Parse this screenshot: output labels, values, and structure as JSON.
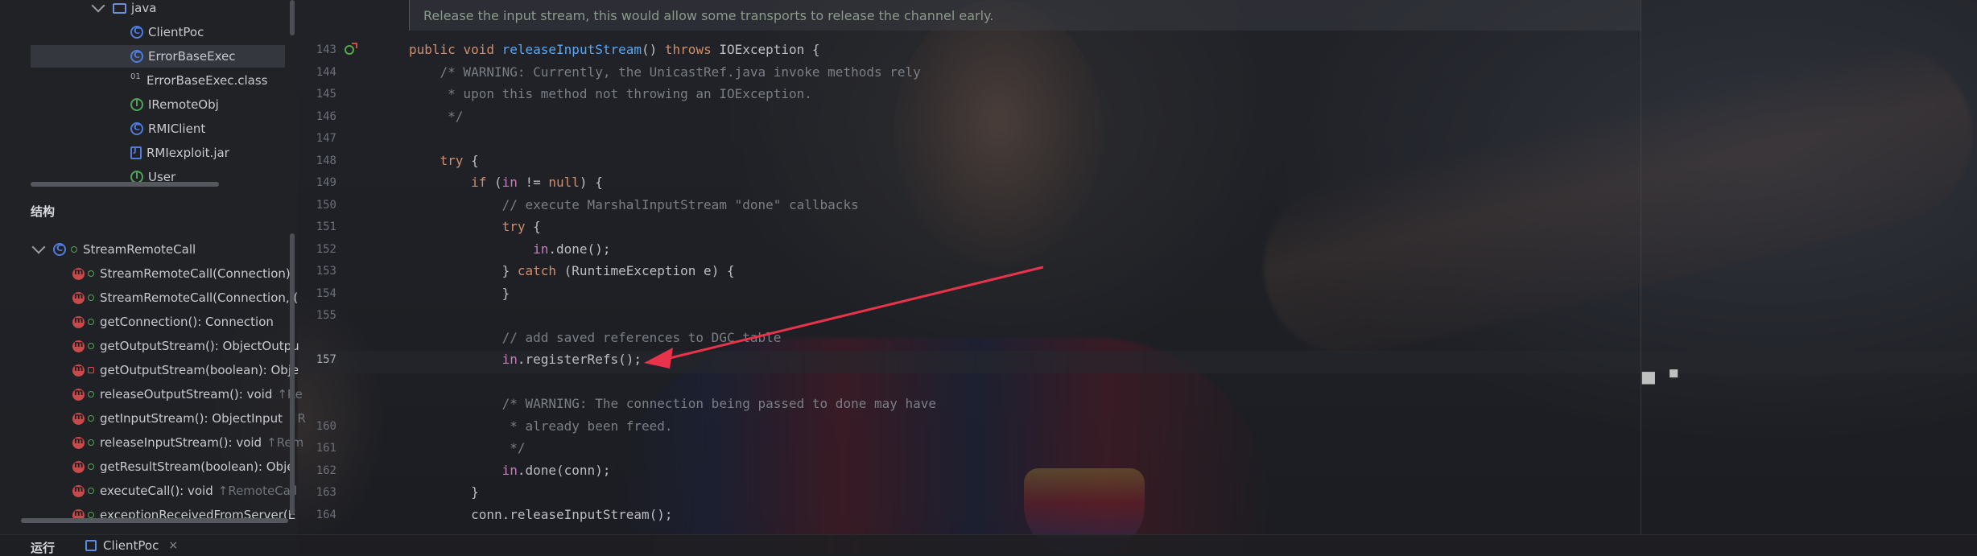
{
  "project_tree": {
    "items": [
      {
        "label": "java",
        "icon": "folder-icon"
      },
      {
        "label": "ClientPoc",
        "icon": "class-icon"
      },
      {
        "label": "ErrorBaseExec",
        "icon": "class-icon"
      },
      {
        "label": "ErrorBaseExec.class",
        "icon": "class-file-icon"
      },
      {
        "label": "IRemoteObj",
        "icon": "interface-icon"
      },
      {
        "label": "RMIClient",
        "icon": "class-icon"
      },
      {
        "label": "RMIexploit.jar",
        "icon": "jar-icon"
      },
      {
        "label": "User",
        "icon": "interface-icon"
      }
    ]
  },
  "structure": {
    "title": "结构",
    "root": "StreamRemoteCall",
    "members": [
      {
        "name": "StreamRemoteCall(Connection)",
        "suffix": "",
        "vis": "public"
      },
      {
        "name": "StreamRemoteCall(Connection, (",
        "suffix": "",
        "vis": "public"
      },
      {
        "name": "getConnection(): Connection",
        "suffix": "",
        "vis": "public"
      },
      {
        "name": "getOutputStream(): ObjectOutpu",
        "suffix": "",
        "vis": "public"
      },
      {
        "name": "getOutputStream(boolean): Obje",
        "suffix": "",
        "vis": "private"
      },
      {
        "name": "releaseOutputStream(): void",
        "suffix": "↑Re",
        "vis": "public"
      },
      {
        "name": "getInputStream(): ObjectInput",
        "suffix": "↑R",
        "vis": "public"
      },
      {
        "name": "releaseInputStream(): void",
        "suffix": "↑Rem",
        "vis": "public"
      },
      {
        "name": "getResultStream(boolean): Obje",
        "suffix": "",
        "vis": "public"
      },
      {
        "name": "executeCall(): void",
        "suffix": "↑RemoteCall",
        "vis": "public"
      },
      {
        "name": "exceptionReceivedFromServer(E",
        "suffix": "",
        "vis": "protected"
      }
    ]
  },
  "bottom": {
    "run_label": "运行",
    "run_tab": "ClientPoc",
    "close_glyph": "×"
  },
  "editor": {
    "doc_comment": "Release the input stream, this would allow some transports to release the channel early.",
    "lines": [
      {
        "num": "143",
        "code": "public void releaseInputStream() throws IOException {"
      },
      {
        "num": "144",
        "code": "    /* WARNING: Currently, the UnicastRef.java invoke methods rely"
      },
      {
        "num": "145",
        "code": "     * upon this method not throwing an IOException."
      },
      {
        "num": "146",
        "code": "     */"
      },
      {
        "num": "147",
        "code": ""
      },
      {
        "num": "148",
        "code": "    try {"
      },
      {
        "num": "149",
        "code": "        if (in != null) {"
      },
      {
        "num": "150",
        "code": "            // execute MarshalInputStream \"done\" callbacks"
      },
      {
        "num": "151",
        "code": "            try {"
      },
      {
        "num": "152",
        "code": "                in.done();"
      },
      {
        "num": "153",
        "code": "            } catch (RuntimeException e) {"
      },
      {
        "num": "154",
        "code": "            }"
      },
      {
        "num": "155",
        "code": ""
      },
      {
        "num": "",
        "code": "            // add saved references to DGC table"
      },
      {
        "num": "157",
        "code": "            in.registerRefs();"
      },
      {
        "num": "",
        "code": ""
      },
      {
        "num": "",
        "code": "            /* WARNING: The connection being passed to done may have"
      },
      {
        "num": "160",
        "code": "             * already been freed."
      },
      {
        "num": "161",
        "code": "             */"
      },
      {
        "num": "162",
        "code": "            in.done(conn);"
      },
      {
        "num": "163",
        "code": "        }"
      },
      {
        "num": "164",
        "code": "        conn.releaseInputStream();"
      }
    ]
  },
  "colors": {
    "keyword": "#cf8e6d",
    "function": "#56a8f5",
    "comment": "#7a7e85",
    "arrow": "#e8334a"
  }
}
